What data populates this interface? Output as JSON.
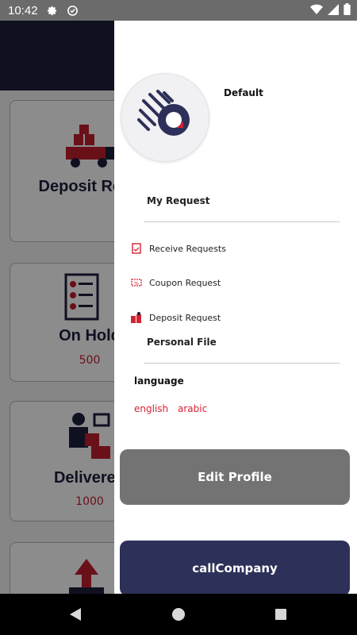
{
  "status_bar": {
    "time": "10:42"
  },
  "background": {
    "cards": [
      {
        "name": "Deposit Requ",
        "value": ""
      },
      {
        "name": "On Hold",
        "value": "500"
      },
      {
        "name": "Delivered",
        "value": "1000"
      }
    ]
  },
  "drawer": {
    "username": "Default",
    "my_request": {
      "title": "My Request",
      "items": [
        {
          "label": "Receive Requests",
          "icon": "receipt-icon"
        },
        {
          "label": "Coupon Request",
          "icon": "coupon-icon"
        },
        {
          "label": "Deposit Request",
          "icon": "deposit-icon"
        }
      ]
    },
    "personal_file": "Personal File",
    "language": {
      "title": "language",
      "options": [
        "english",
        "arabic"
      ]
    },
    "edit_profile": "Edit Profile",
    "call_company": "callCompany"
  },
  "colors": {
    "accent": "#d42233",
    "navy": "#2d3058",
    "gray_button": "#737373"
  }
}
